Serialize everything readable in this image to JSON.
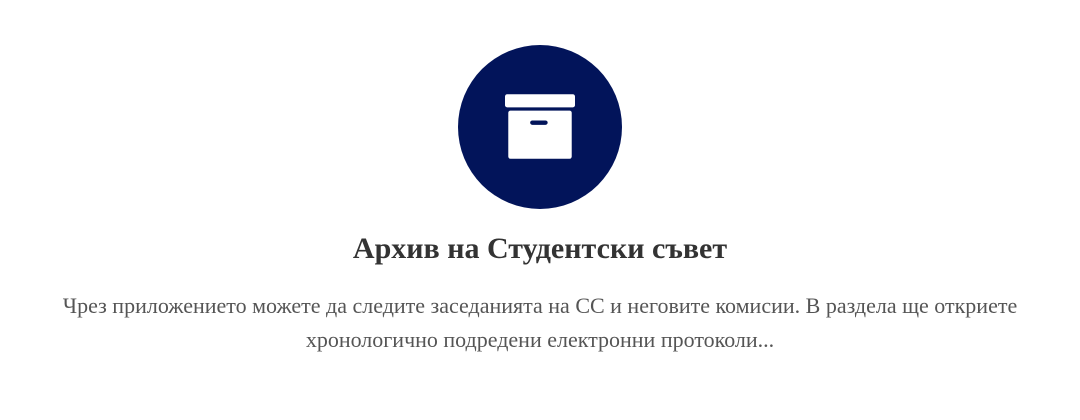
{
  "colors": {
    "accent": "#02145a",
    "title": "#333333",
    "text": "#555555",
    "background": "#ffffff"
  },
  "card": {
    "icon": "archive-box-icon",
    "title": "Архив на Студентски съвет",
    "description": "Чрез приложението можете да следите заседанията на СС и неговите комисии. В раздела ще откриете хронологично подредени електронни протоколи..."
  }
}
